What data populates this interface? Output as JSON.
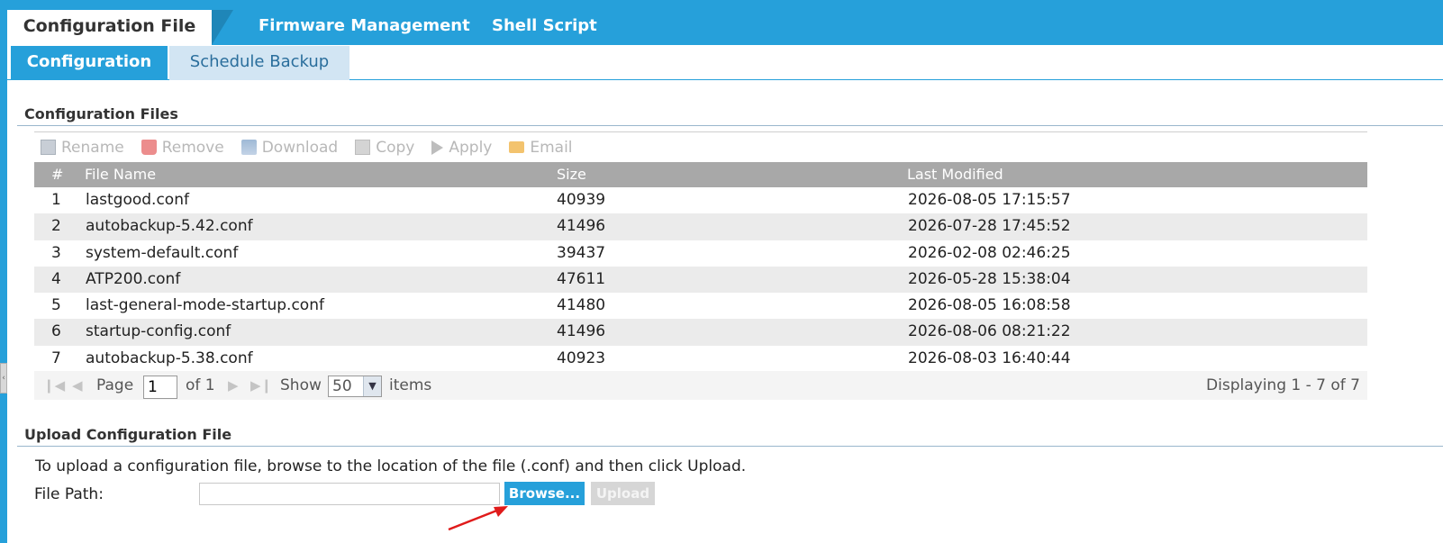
{
  "main_tabs": [
    {
      "label": "Configuration File",
      "active": true
    },
    {
      "label": "Firmware Management",
      "active": false
    },
    {
      "label": "Shell Script",
      "active": false
    }
  ],
  "sub_tabs": [
    {
      "label": "Configuration",
      "active": true
    },
    {
      "label": "Schedule Backup",
      "active": false
    }
  ],
  "config_files": {
    "section_title": "Configuration Files",
    "toolbar": [
      {
        "label": "Rename",
        "icon": "rename-icon"
      },
      {
        "label": "Remove",
        "icon": "trash-icon"
      },
      {
        "label": "Download",
        "icon": "download-icon"
      },
      {
        "label": "Copy",
        "icon": "copy-icon"
      },
      {
        "label": "Apply",
        "icon": "play-icon"
      },
      {
        "label": "Email",
        "icon": "envelope-icon"
      }
    ],
    "columns": [
      "#",
      "File Name",
      "Size",
      "Last Modified"
    ],
    "rows": [
      {
        "num": "1",
        "name": "lastgood.conf",
        "size": "40939",
        "modified": "2026-08-05 17:15:57"
      },
      {
        "num": "2",
        "name": "autobackup-5.42.conf",
        "size": "41496",
        "modified": "2026-07-28 17:45:52"
      },
      {
        "num": "3",
        "name": "system-default.conf",
        "size": "39437",
        "modified": "2026-02-08 02:46:25"
      },
      {
        "num": "4",
        "name": "ATP200.conf",
        "size": "47611",
        "modified": "2026-05-28 15:38:04"
      },
      {
        "num": "5",
        "name": "last-general-mode-startup.conf",
        "size": "41480",
        "modified": "2026-08-05 16:08:58"
      },
      {
        "num": "6",
        "name": "startup-config.conf",
        "size": "41496",
        "modified": "2026-08-06 08:21:22"
      },
      {
        "num": "7",
        "name": "autobackup-5.38.conf",
        "size": "40923",
        "modified": "2026-08-03 16:40:44"
      }
    ],
    "pager": {
      "page_label": "Page",
      "page_value": "1",
      "of_label": "of 1",
      "show_label": "Show",
      "show_value": "50",
      "items_label": "items",
      "displaying": "Displaying 1 - 7 of 7"
    }
  },
  "upload": {
    "section_title": "Upload Configuration File",
    "instruction": "To upload a configuration file, browse to the location of the file (.conf) and then click Upload.",
    "file_path_label": "File Path:",
    "file_path_value": "",
    "browse_label": "Browse...",
    "upload_label": "Upload"
  },
  "colors": {
    "accent": "#26a0da",
    "header_gray": "#a8a8a8",
    "annotation_arrow": "#e01b1b"
  }
}
